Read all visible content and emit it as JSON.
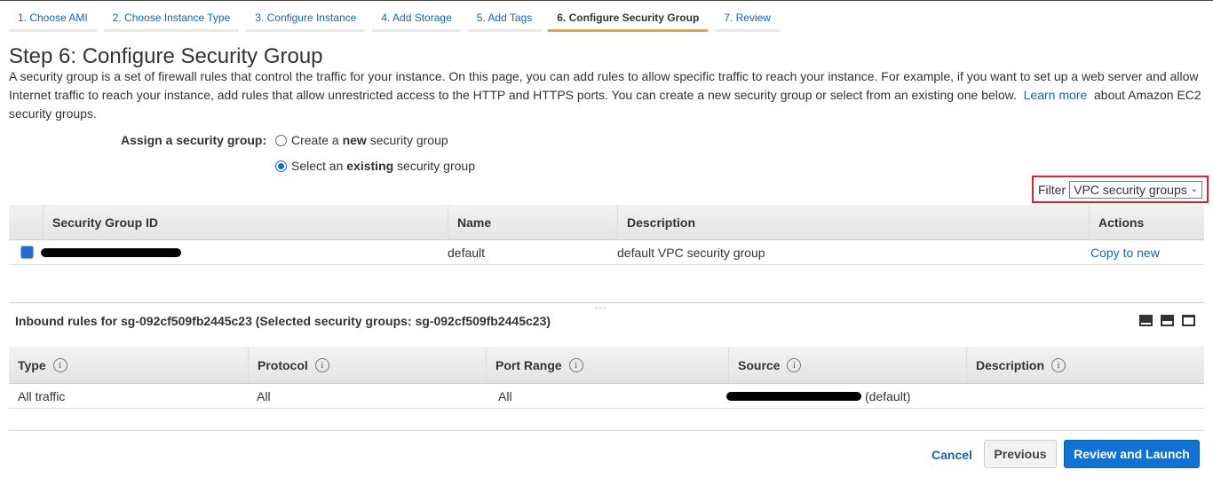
{
  "tabs": [
    "1. Choose AMI",
    "2. Choose Instance Type",
    "3. Configure Instance",
    "4. Add Storage",
    "5. Add Tags",
    "6. Configure Security Group",
    "7. Review"
  ],
  "title": "Step 6: Configure Security Group",
  "description": {
    "text": "A security group is a set of firewall rules that control the traffic for your instance. On this page, you can add rules to allow specific traffic to reach your instance. For example, if you want to set up a web server and allow Internet traffic to reach your instance, add rules that allow unrestricted access to the HTTP and HTTPS ports. You can create a new security group or select from an existing one below.",
    "link": "Learn more",
    "suffix": "about Amazon EC2 security groups."
  },
  "assign": {
    "label": "Assign a security group:",
    "opt1": [
      "Create a ",
      "new",
      " security group"
    ],
    "opt2": [
      "Select an ",
      "existing",
      " security group"
    ],
    "selected": "existing"
  },
  "filter": {
    "label": "Filter",
    "value": "VPC security groups"
  },
  "sg_table": {
    "headers": [
      "Security Group ID",
      "Name",
      "Description",
      "Actions"
    ],
    "rows": [
      {
        "name": "default",
        "description": "default VPC security group",
        "action": "Copy to new",
        "checked": true
      }
    ]
  },
  "inbound": {
    "heading": "Inbound rules for sg-092cf509fb2445c23 (Selected security groups: sg-092cf509fb2445c23)",
    "headers": [
      "Type",
      "Protocol",
      "Port Range",
      "Source",
      "Description"
    ],
    "rows": [
      {
        "type": "All traffic",
        "protocol": "All",
        "port": "All",
        "source_suffix": "(default)"
      }
    ]
  },
  "footer": {
    "cancel": "Cancel",
    "previous": "Previous",
    "launch": "Review and Launch"
  },
  "colors": {
    "accent": "#f0a035",
    "link": "#1166bb",
    "primary": "#0f73d6",
    "highlight": "#e0212c"
  }
}
